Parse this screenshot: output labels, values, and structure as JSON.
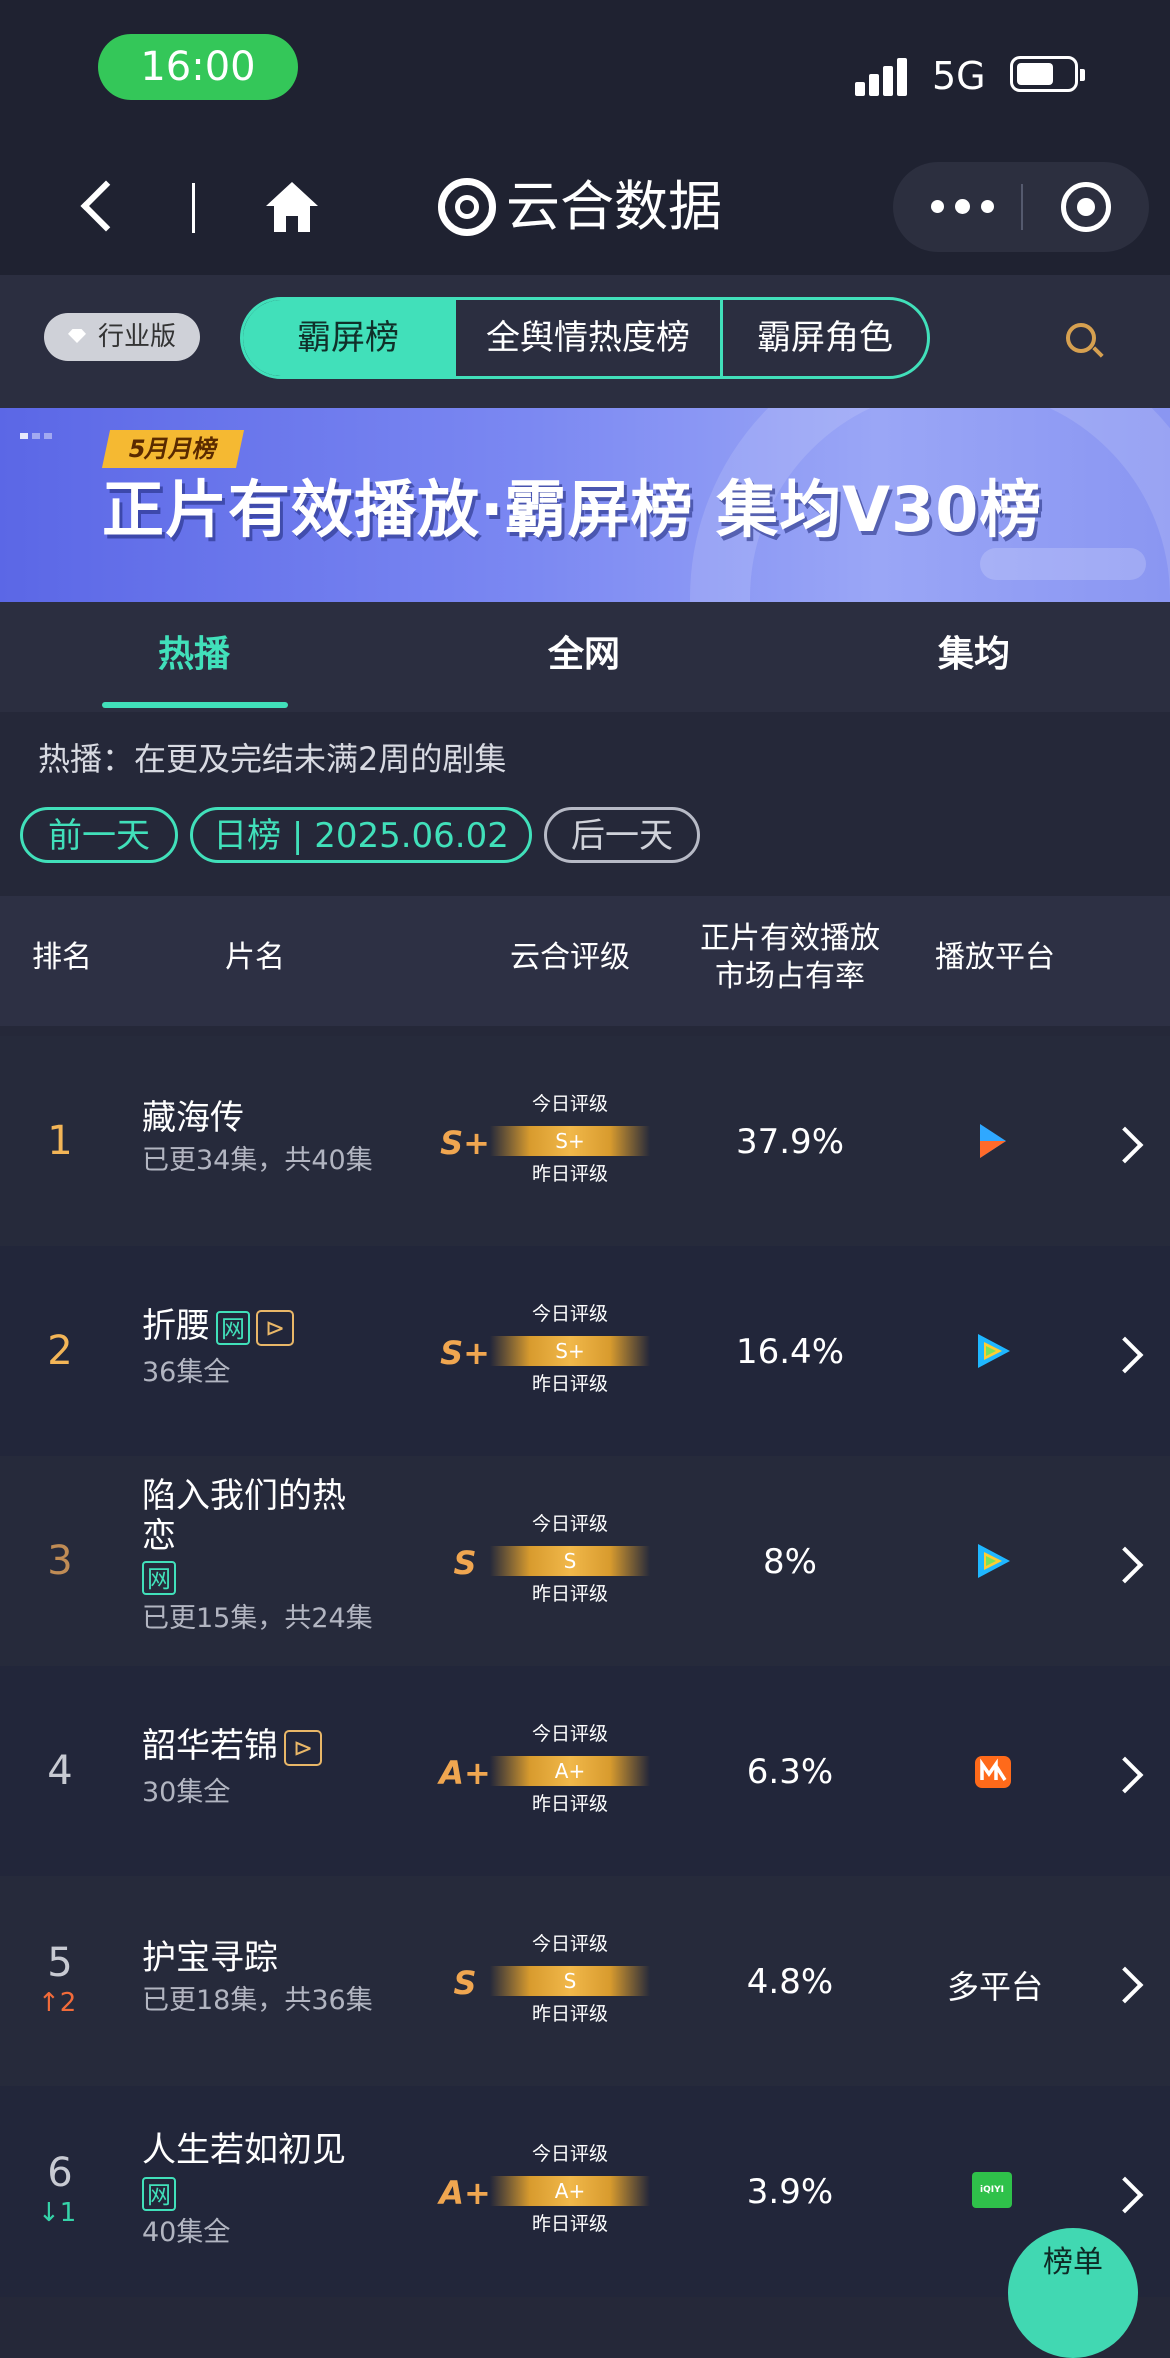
{
  "status_bar": {
    "time": "16:00",
    "network": "5G"
  },
  "nav": {
    "brand": "云合数据"
  },
  "subheader": {
    "edition_badge": "行业版",
    "segments": [
      "霸屏榜",
      "全舆情热度榜",
      "霸屏角色"
    ],
    "active_segment": 0
  },
  "banner": {
    "badge": "5月月榜",
    "title": "正片有效播放·霸屏榜 集均V30榜"
  },
  "tabs": [
    "热播",
    "全网",
    "集均"
  ],
  "active_tab": 0,
  "description": "热播：在更及完结未满2周的剧集",
  "date_controls": {
    "prev": "前一天",
    "current": "日榜 | 2025.06.02",
    "next": "后一天"
  },
  "table": {
    "headers": {
      "rank": "排名",
      "title": "片名",
      "grade": "云合评级",
      "share_line1": "正片有效播放",
      "share_line2": "市场占有率",
      "platform": "播放平台"
    },
    "rating_labels": {
      "today": "今日评级",
      "yesterday": "昨日评级"
    },
    "rows": [
      {
        "rank": "1",
        "title": "藏海传",
        "subtitle": "已更34集，共40集",
        "grade": "S+",
        "grade_today": "S+",
        "share": "37.9%",
        "platform_icon": "youku-icon"
      },
      {
        "rank": "2",
        "title": "折腰",
        "tag_net": "网",
        "tag_ff": "⊳",
        "subtitle": "36集全",
        "grade": "S+",
        "grade_today": "S+",
        "share": "16.4%",
        "platform_icon": "tencent-video-icon"
      },
      {
        "rank": "3",
        "title_line1": "陷入我们的热",
        "title_line2": "恋",
        "tag_net": "网",
        "subtitle": "已更15集，共24集",
        "grade": "S",
        "grade_today": "S",
        "share": "8%",
        "platform_icon": "tencent-video-icon"
      },
      {
        "rank": "4",
        "title": "韶华若锦",
        "tag_ff": "⊳",
        "subtitle": "30集全",
        "grade": "A+",
        "grade_today": "A+",
        "share": "6.3%",
        "platform_icon": "mango-tv-icon"
      },
      {
        "rank": "5",
        "rank_change": "2",
        "title": "护宝寻踪",
        "subtitle": "已更18集，共36集",
        "grade": "S",
        "grade_today": "S",
        "share": "4.8%",
        "platform_text": "多平台"
      },
      {
        "rank": "6",
        "rank_change": "1",
        "title": "人生若如初见",
        "tag_net": "网",
        "subtitle": "40集全",
        "grade": "A+",
        "grade_today": "A+",
        "share": "3.9%",
        "platform_icon": "iqiyi-icon",
        "platform_icon_text": "iQIYI"
      }
    ]
  },
  "fab": {
    "label": "榜单"
  },
  "colors": {
    "accent": "#41e0ba",
    "gold": "#f3b557",
    "background": "#252839"
  }
}
